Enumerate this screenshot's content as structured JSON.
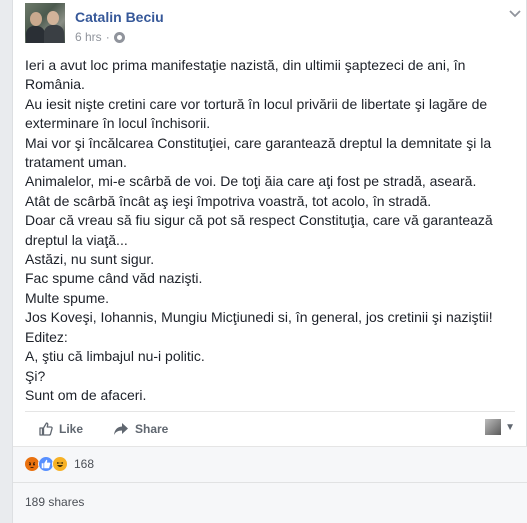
{
  "post": {
    "author": "Catalin Beciu",
    "time": "6 hrs",
    "separator": "·",
    "lines": [
      "Ieri a avut loc prima manifestaţie nazistă, din ultimii şaptezeci de ani, în",
      "România.",
      "Au iesit nişte cretini care vor tortură în locul privării de libertate şi lagăre de",
      "exterminare în locul închisorii.",
      "Mai vor şi încălcarea Constituţiei, care garantează dreptul la demnitate şi la",
      "tratament uman.",
      "Animalelor, mi-e scârbă de voi. De toţi ăia care aţi fost pe stradă, aseară.",
      "Atât de scârbă încât aş ieşi împotriva voastră, tot acolo, în stradă.",
      "Doar că vreau să fiu sigur că pot să respect Constituţia, care vă garantează",
      "dreptul la viaţă...",
      "Astăzi, nu sunt sigur.",
      "Fac spume când văd nazişti.",
      "Multe spume.",
      "Jos Koveşi, Iohannis, Mungiu Micţiunedi si, în general, jos cretinii şi naziştii!",
      "Editez:",
      "A, ştiu că limbajul nu-i politic.",
      "Şi?",
      "Sunt om de afaceri."
    ]
  },
  "actions": {
    "like_label": "Like",
    "share_label": "Share"
  },
  "reactions": {
    "count": "168",
    "icons": [
      "angry-icon",
      "like-icon",
      "haha-icon"
    ]
  },
  "shares": {
    "label": "189 shares"
  },
  "colors": {
    "link": "#365899",
    "meta": "#90949c",
    "text": "#1d2129",
    "background": "#e9ebee"
  }
}
